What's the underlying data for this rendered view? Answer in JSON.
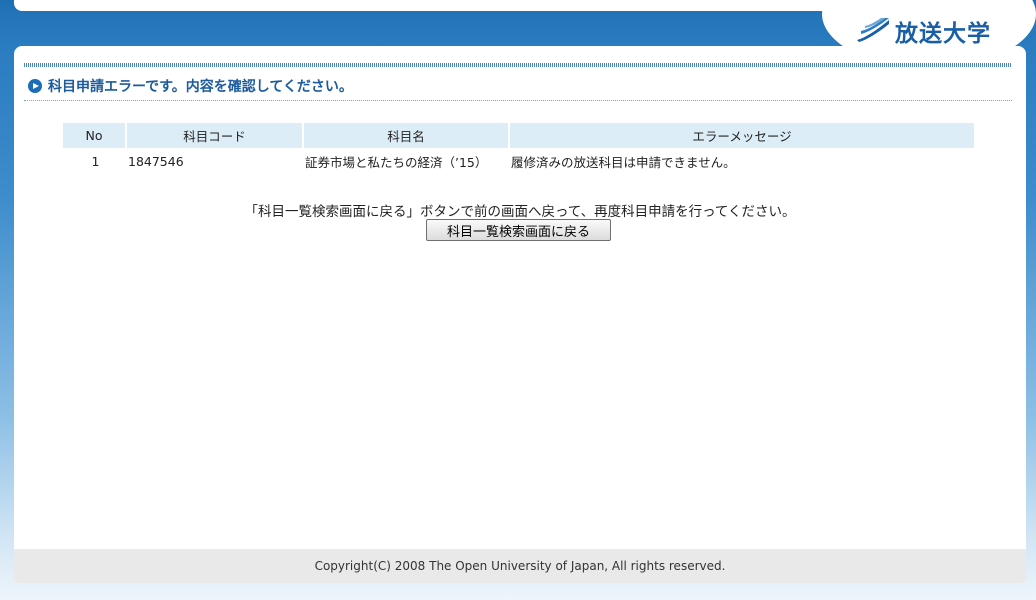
{
  "brand": {
    "name": "放送大学",
    "color": "#1a5fa5"
  },
  "heading": {
    "text": "科目申請エラーです。内容を確認してください。"
  },
  "table": {
    "headers": [
      "No",
      "科目コード",
      "科目名",
      "エラーメッセージ"
    ],
    "rows": [
      {
        "no": "1",
        "code": "1847546",
        "name": "証券市場と私たちの経済（’15）",
        "message": "履修済みの放送科目は申請できません。"
      }
    ]
  },
  "notice": "「科目一覧検索画面に戻る」ボタンで前の画面へ戻って、再度科目申請を行ってください。",
  "back_button": {
    "label": "科目一覧検索画面に戻る"
  },
  "footer": {
    "copyright": "Copyright(C) 2008 The Open University of Japan, All rights reserved."
  },
  "colors": {
    "accent": "#1c6db5",
    "table_header_bg": "#dcedf7"
  }
}
